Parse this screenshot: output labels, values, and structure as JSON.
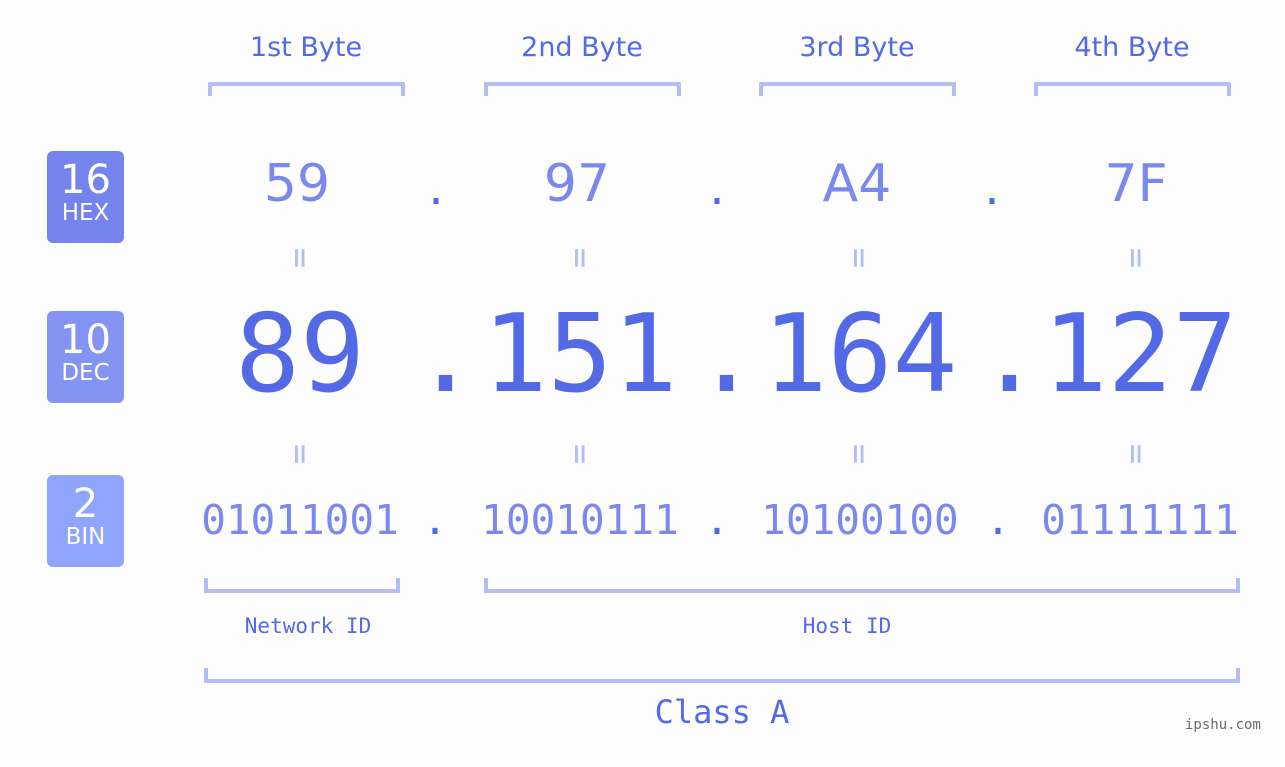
{
  "bytes": [
    {
      "label": "1st Byte",
      "hex": "59",
      "dec": "89",
      "bin": "01011001"
    },
    {
      "label": "2nd Byte",
      "hex": "97",
      "dec": "151",
      "bin": "10010111"
    },
    {
      "label": "3rd Byte",
      "hex": "A4",
      "dec": "164",
      "bin": "10100100"
    },
    {
      "label": "4th Byte",
      "hex": "7F",
      "dec": "127",
      "bin": "01111111"
    }
  ],
  "badges": {
    "hex": {
      "base": "16",
      "label": "HEX",
      "color": "#7583ec"
    },
    "dec": {
      "base": "10",
      "label": "DEC",
      "color": "#8394f3"
    },
    "bin": {
      "base": "2",
      "label": "BIN",
      "color": "#8ea5fb"
    }
  },
  "separator": ".",
  "equals": "=",
  "network_id_label": "Network ID",
  "host_id_label": "Host ID",
  "class_label": "Class A",
  "watermark": "ipshu.com",
  "colors": {
    "accent": "#5369e6",
    "light": "#7b88ee",
    "bracket": "#b3bdf6"
  }
}
